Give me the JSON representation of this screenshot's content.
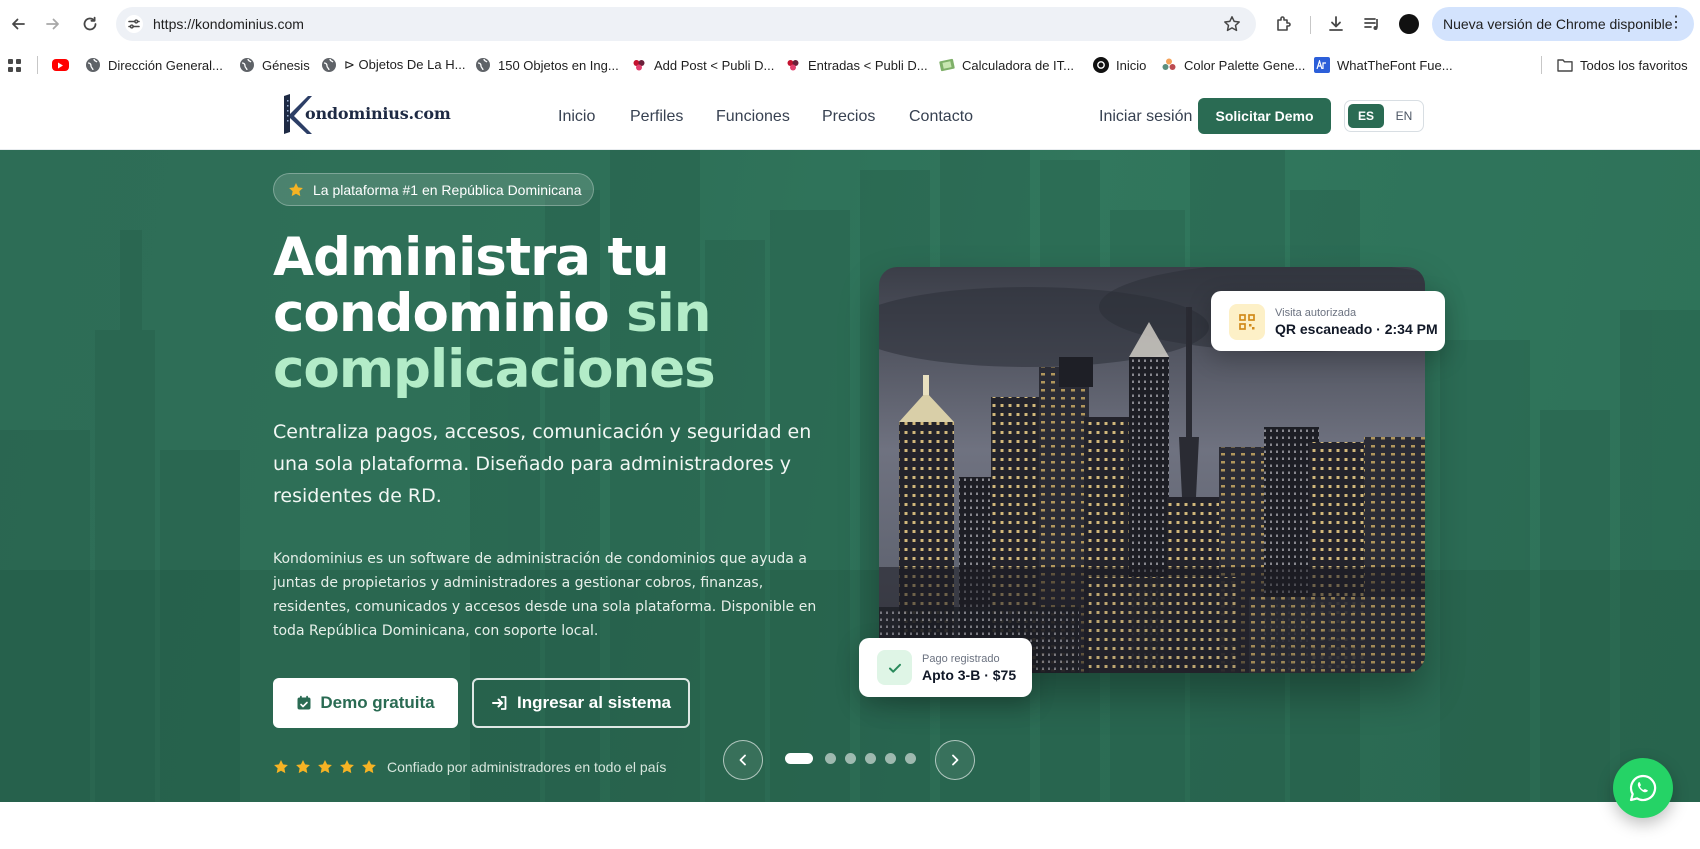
{
  "browser": {
    "url": "https://kondominius.com",
    "update_label": "Nueva versión de Chrome disponible",
    "icons": [
      "back-arrow-icon",
      "forward-arrow-icon",
      "reload-icon",
      "site-settings-icon",
      "bookmark-star-icon",
      "extensions-icon",
      "download-icon",
      "media-queue-icon",
      "kebab-menu-icon"
    ],
    "bookmarks": [
      {
        "label": "Dirección General...",
        "icon": "globe-icon"
      },
      {
        "label": "Génesis",
        "icon": "globe-icon"
      },
      {
        "label": "⊳ Objetos De La H...",
        "icon": "globe-icon"
      },
      {
        "label": "150 Objetos en Ing...",
        "icon": "globe-icon"
      },
      {
        "label": "Add Post < Publi D...",
        "icon": "site-favicon"
      },
      {
        "label": "Entradas < Publi D...",
        "icon": "site-favicon"
      },
      {
        "label": "Calculadora de IT...",
        "icon": "calculator-favicon"
      },
      {
        "label": "Inicio",
        "icon": "threads-favicon"
      },
      {
        "label": "Color Palette Gene...",
        "icon": "palette-favicon"
      },
      {
        "label": "WhatTheFont Fue...",
        "icon": "font-favicon"
      }
    ],
    "all_bookmarks_label": "Todos los favoritos"
  },
  "site": {
    "logo_text": "ondominius.com",
    "logo_initial": "K",
    "nav": [
      "Inicio",
      "Perfiles",
      "Funciones",
      "Precios",
      "Contacto"
    ],
    "login_label": "Iniciar sesión",
    "demo_label": "Solicitar Demo",
    "lang": {
      "es": "ES",
      "en": "EN",
      "active": "ES"
    }
  },
  "hero": {
    "badge": "La plataforma #1 en República Dominicana",
    "title_line1": "Administra tu",
    "title_line2_a": "condominio ",
    "title_line2_b": "sin",
    "title_line3": "complicaciones",
    "lead": "Centraliza pagos, accesos, comunicación y seguridad en una sola plataforma. Diseñado para administradores y residentes de RD.",
    "description": "Kondominius es un software de administración de condominios que ayuda a juntas de propietarios y administradores a gestionar cobros, finanzas, residentes, comunicados y accesos desde una sola plataforma. Disponible en toda República Dominicana, con soporte local.",
    "primary_cta": "Demo gratuita",
    "secondary_cta": "Ingresar al sistema",
    "trust_text": "Confiado por administradores en todo el país",
    "rating_stars": 5,
    "card_visit": {
      "small": "Visita autorizada",
      "big": "QR escaneado · 2:34 PM"
    },
    "card_payment": {
      "small": "Pago registrado",
      "big": "Apto 3-B · $75"
    },
    "carousel": {
      "slides": 6,
      "active": 1
    }
  },
  "colors": {
    "brand_green": "#2a6b53",
    "accent_mint": "#b3ecc8",
    "star_gold": "#f5b324",
    "whatsapp": "#25d366",
    "update_pill": "#d3e3fd"
  }
}
